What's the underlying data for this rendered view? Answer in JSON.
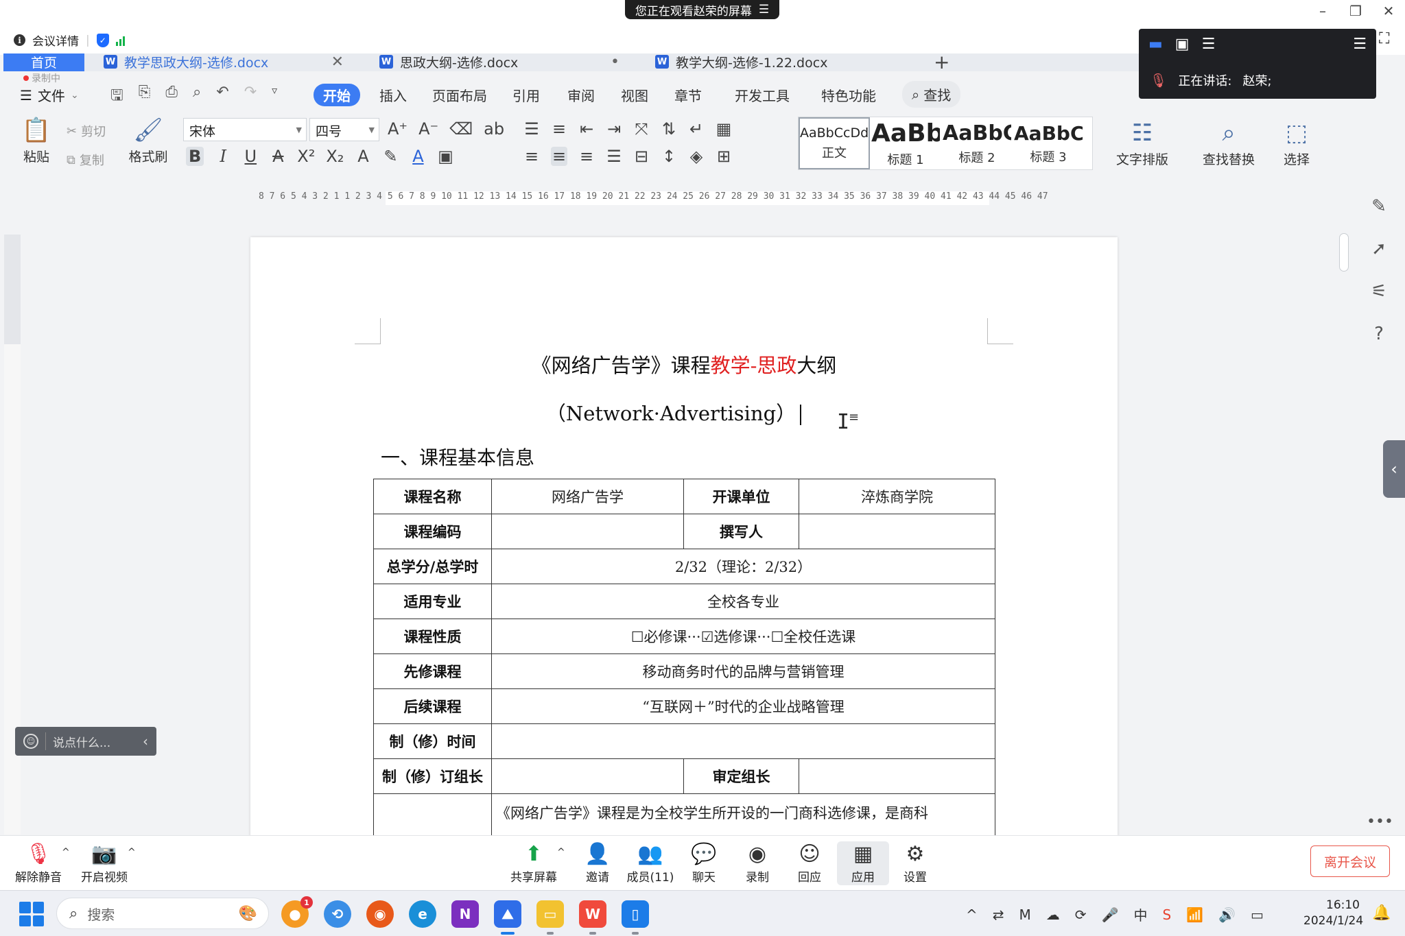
{
  "meeting": {
    "share_banner": "您正在观看赵荣的屏幕",
    "share_banner_icon": "menu-icon",
    "info_label": "会议详情",
    "speaking_label": "正在讲话:",
    "speaker_name": "赵荣;",
    "chat_placeholder": "说点什么...",
    "toolbar": {
      "unmute": "解除静音",
      "start_video": "开启视频",
      "share_screen": "共享屏幕",
      "invite": "邀请",
      "members": "成员(11)",
      "chat": "聊天",
      "record": "录制",
      "reactions": "回应",
      "apps": "应用",
      "settings": "设置",
      "leave": "离开会议"
    }
  },
  "wps": {
    "tabs": {
      "home": "首页",
      "doc1": "教学思政大纲-选修.docx",
      "doc2": "思政大纲-选修.docx",
      "doc3": "教学大纲-选修-1.22.docx"
    },
    "recording_badge": "录制中",
    "menu": {
      "file": "文件",
      "start": "开始",
      "insert": "插入",
      "page_layout": "页面布局",
      "references": "引用",
      "review": "审阅",
      "view": "视图",
      "chapter": "章节",
      "developer": "开发工具",
      "special": "特色功能",
      "search": "查找"
    },
    "ribbon": {
      "paste": "粘贴",
      "cut": "剪切",
      "copy": "复制",
      "format_painter": "格式刷",
      "font_name": "宋体",
      "font_size": "四号",
      "styles": [
        {
          "preview": "AaBbCcDd",
          "name": "正文"
        },
        {
          "preview": "AaBb",
          "name": "标题 1"
        },
        {
          "preview": "AaBbC",
          "name": "标题 2"
        },
        {
          "preview": "AaBbC",
          "name": "标题 3"
        }
      ],
      "text_layout": "文字排版",
      "find_replace": "查找替换",
      "select": "选择"
    },
    "ruler_numbers": "8 7 6 5 4 3 2 1   1 2 3 4 5 6 7 8 9 10 11 12 13 14 15 16 17 18 19 20 21 22 23 24 25 26 27 28 29 30 31 32 33 34 35 36 37 38 39 40 41 42 43 44 45 46 47"
  },
  "document": {
    "title_part1": "《网络广告学》课程",
    "title_red": "教学-思政",
    "title_part2": "大纲",
    "subtitle": "（Network·Advertising）",
    "section_heading": "一、课程基本信息",
    "table": {
      "course_name_label": "课程名称",
      "course_name": "网络广告学",
      "dept_label": "开课单位",
      "dept": "淬炼商学院",
      "code_label": "课程编码",
      "code": "",
      "author_label": "撰写人",
      "author": "",
      "credits_label": "总学分/总学时",
      "credits": "2/32（理论：2/32）",
      "major_label": "适用专业",
      "major": "全校各专业",
      "nature_label": "课程性质",
      "nature": "☐必修课···☑选修课···☐全校任选课",
      "prereq_label": "先修课程",
      "prereq": "移动商务时代的品牌与营销管理",
      "followup_label": "后续课程",
      "followup": "“互联网＋”时代的企业战略管理",
      "revise_time_label": "制（修）时间",
      "revise_time": "",
      "revise_lead_label": "制（修）订组长",
      "revise_lead": "",
      "review_lead_label": "审定组长",
      "review_lead": "",
      "description": "《网络广告学》课程是为全校学生所开设的一门商科选修课，是商科"
    }
  },
  "taskbar": {
    "search_placeholder": "搜索",
    "time": "16:10",
    "date": "2024/1/24",
    "mail_badge": "1"
  }
}
